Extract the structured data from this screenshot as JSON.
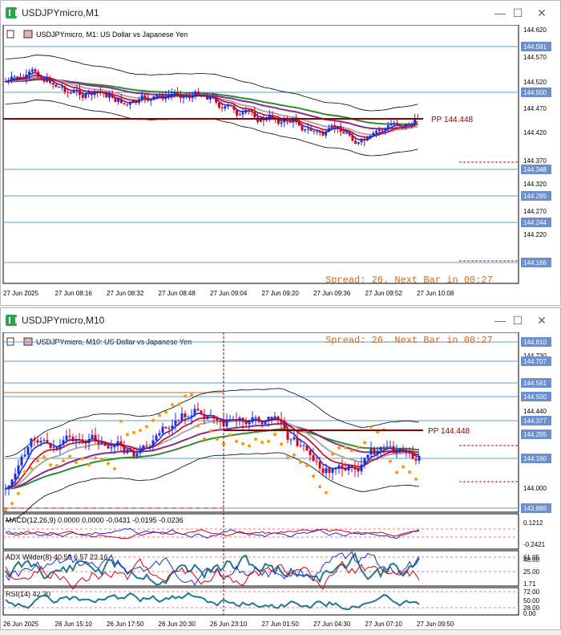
{
  "win1": {
    "title": "USDJPYmicro,M1",
    "chart_label": "USDJPYmicro, M1:  US Dollar vs Japanese Yen",
    "price_axis": [
      "144.620",
      "144.591",
      "144.570",
      "144.520",
      "144.500",
      "144.470",
      "144.420",
      "144.370",
      "144.348",
      "144.320",
      "144.295",
      "144.270",
      "144.244",
      "144.220",
      "144.170",
      "144.166"
    ],
    "time_axis": [
      "27 Jun 2025",
      "27 Jun 08:16",
      "27 Jun 08:32",
      "27 Jun 08:48",
      "27 Jun 09:04",
      "27 Jun 09:20",
      "27 Jun 09:36",
      "27 Jun 09:52",
      "27 Jun 10:08"
    ],
    "pivot_label": "PP 144.448",
    "spread_text": "Spread: 26. Next Bar in 00:27"
  },
  "win2": {
    "title": "USDJPYmicro,M10",
    "chart_label": "USDJPYmicro, M10:  US Dollar vs Japanese Yen",
    "price_axis": [
      "144.810",
      "144.730",
      "144.707",
      "144.591",
      "144.500",
      "144.440",
      "144.377",
      "144.295",
      "144.160",
      "144.000",
      "143.886"
    ],
    "time_axis": [
      "26 Jun 2025",
      "26 Jun 15:10",
      "26 Jun 17:50",
      "26 Jun 20:30",
      "26 Jun 23:10",
      "27 Jun 01:50",
      "27 Jun 04:30",
      "27 Jun 07:10",
      "27 Jun 09:50"
    ],
    "pivot_label": "PP 144.448",
    "spread_text": "Spread: 26. Next Bar in 08:27",
    "macd_label": "MACD(12,26,9) 0.0000 0.0000 -0.0431 -0.0195 -0.0236",
    "macd_axis": [
      "0.1212",
      "-0.2421"
    ],
    "adx_label": "ADX Wilder(8) 40.59 6.57 23.16",
    "adx_axis": [
      "61.05",
      "48.00",
      "25.00",
      "1.71"
    ],
    "rsi_label": "RSI(14) 42.30",
    "rsi_axis": [
      "72.00",
      "50.00",
      "28.00",
      "0.00"
    ]
  },
  "colors": {
    "bull": "#1c2fd8",
    "bear": "#d0021b",
    "ma_green": "#2e8b2e",
    "ma_purple": "#8b2a8b",
    "ma_gray": "#aaaaaa",
    "pivot": "#8b0000",
    "sar": "#ff9900",
    "grid": "#5b9bd5"
  },
  "icons": [
    "app-logo-icon",
    "minimize-icon",
    "maximize-icon",
    "close-icon",
    "chart-menu-icon"
  ]
}
